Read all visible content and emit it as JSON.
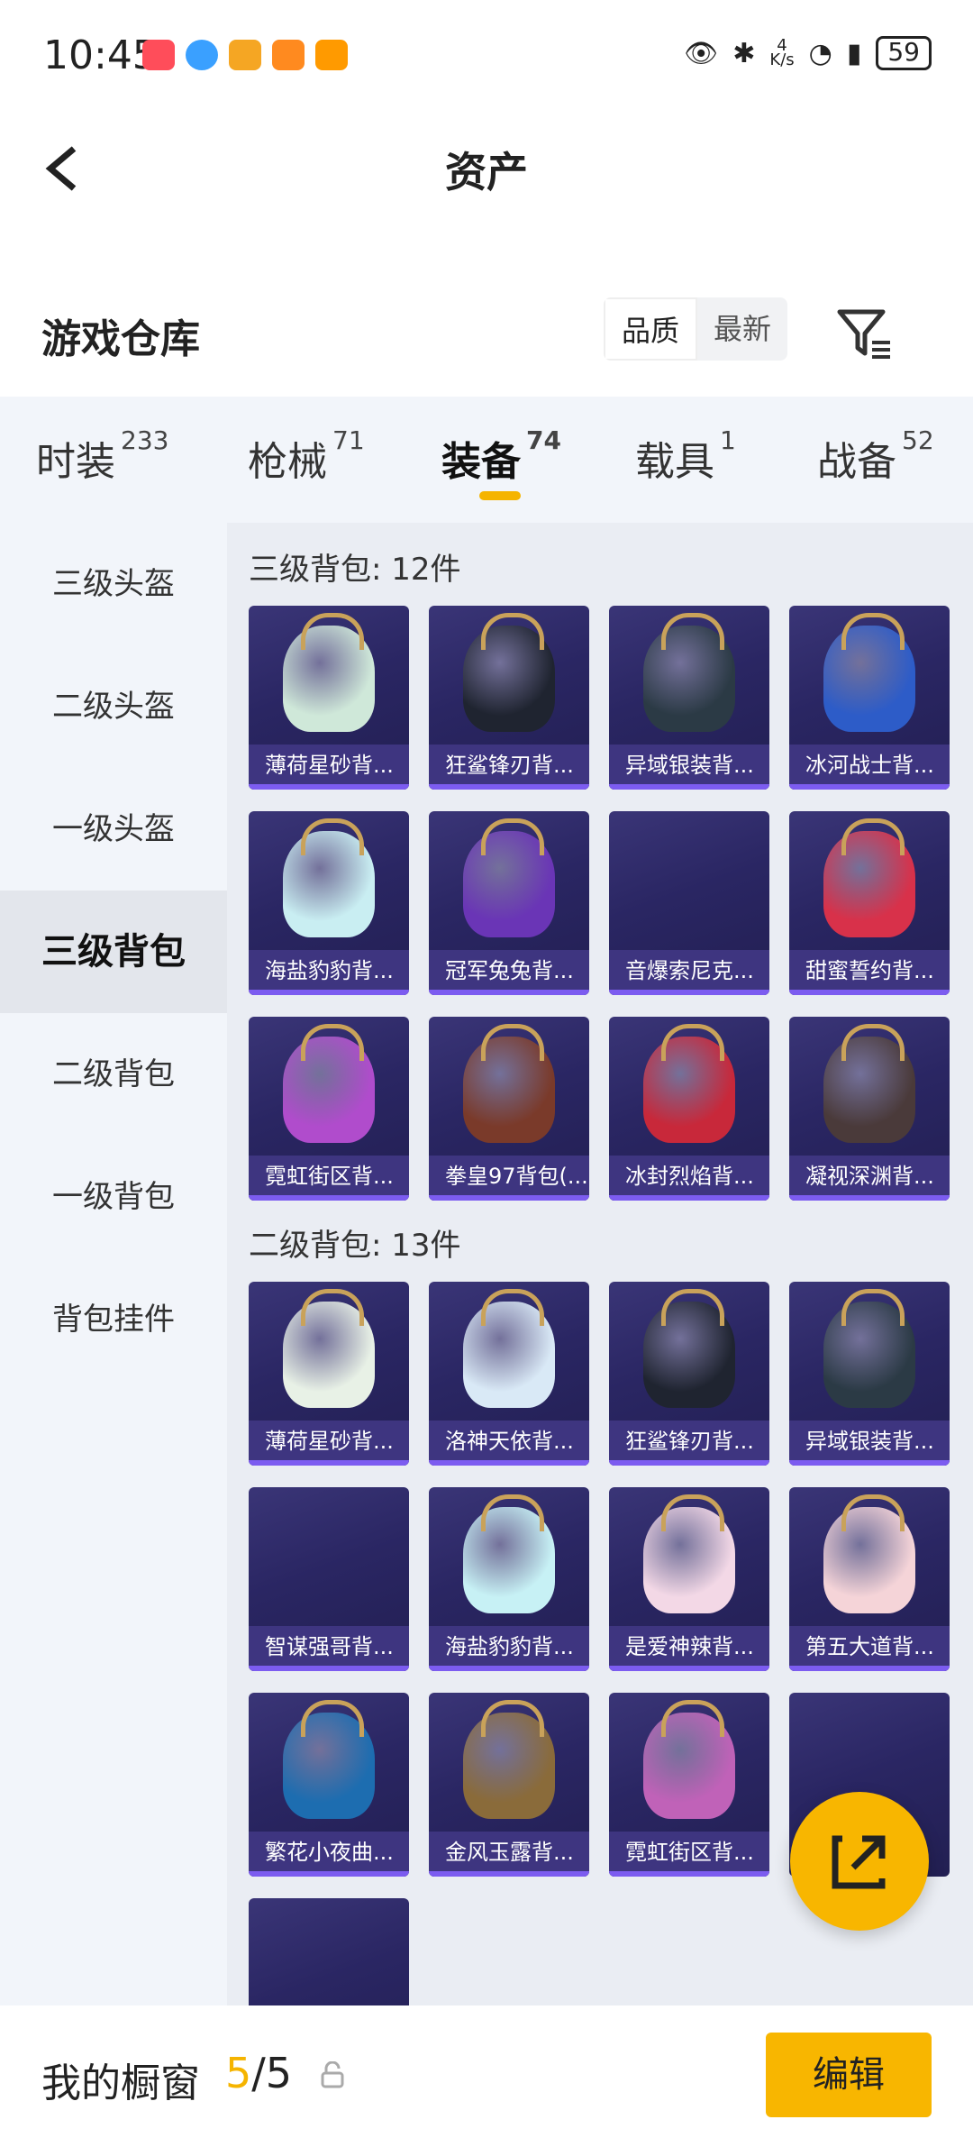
{
  "status": {
    "time": "10:45",
    "net_top": "4",
    "net_bottom": "K/s",
    "battery": "59"
  },
  "header": {
    "title": "资产"
  },
  "warehouse": {
    "title": "游戏仓库",
    "sort": [
      "品质",
      "最新"
    ]
  },
  "tabs": [
    {
      "label": "时装",
      "count": "233"
    },
    {
      "label": "枪械",
      "count": "71"
    },
    {
      "label": "装备",
      "count": "74"
    },
    {
      "label": "载具",
      "count": "1"
    },
    {
      "label": "战备",
      "count": "52"
    }
  ],
  "sidebar": [
    "三级头盔",
    "二级头盔",
    "一级头盔",
    "三级背包",
    "二级背包",
    "一级背包",
    "背包挂件"
  ],
  "sections": [
    {
      "title": "三级背包: 12件",
      "items": [
        "薄荷星砂背...",
        "狂鲨锋刃背...",
        "异域银装背...",
        "冰河战士背...",
        "海盐豹豹背...",
        "冠军兔兔背...",
        "音爆索尼克...",
        "甜蜜誓约背...",
        "霓虹街区背...",
        "拳皇97背包(...",
        "冰封烈焰背...",
        "凝视深渊背..."
      ]
    },
    {
      "title": "二级背包: 13件",
      "items": [
        "薄荷星砂背...",
        "洛神天依背...",
        "狂鲨锋刃背...",
        "异域银装背...",
        "智谋强哥背...",
        "海盐豹豹背...",
        "是爱神辣背...",
        "第五大道背...",
        "繁花小夜曲...",
        "金风玉露背...",
        "霓虹街区背...",
        "",
        ""
      ]
    }
  ],
  "bottom": {
    "title": "我的橱窗",
    "count_used": "5",
    "count_sep": "/",
    "count_total": "5",
    "edit": "编辑"
  },
  "colors": {
    "accent": "#f8b600",
    "card_bg": "#2a2663",
    "card_label": "#3e3580"
  }
}
